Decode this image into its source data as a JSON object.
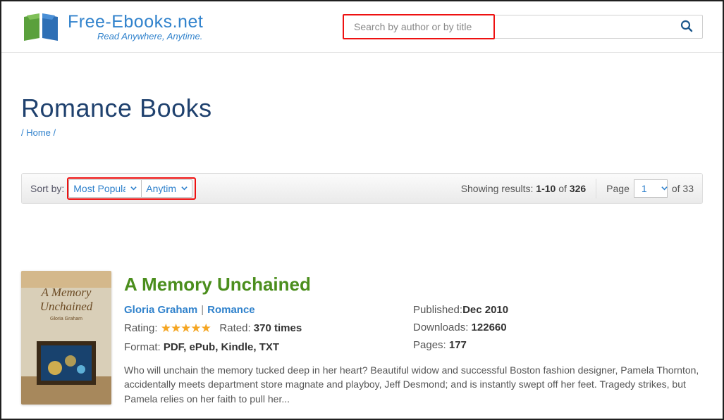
{
  "header": {
    "brand": "Free-Ebooks.net",
    "tagline": "Read Anywhere, Anytime.",
    "search_placeholder": "Search by author or by title"
  },
  "page": {
    "title": "Romance Books",
    "breadcrumb": "/ Home /"
  },
  "filter": {
    "sort_label": "Sort by:",
    "sort_value": "Most Popular",
    "date_value": "Anytime",
    "showing_prefix": "Showing results: ",
    "range": "1-10",
    "of_word": " of ",
    "total_results": "326",
    "page_label": "Page",
    "page_value": "1",
    "of_total_pages": "of 33"
  },
  "book": {
    "title": "A Memory Unchained",
    "author": "Gloria Graham",
    "category": "Romance",
    "rating_label": "Rating: ",
    "rated_label": "Rated: ",
    "rating_count": "370 times",
    "format_label": "Format: ",
    "format_value": "PDF, ePub, Kindle, TXT",
    "published_label": "Published: ",
    "published_value": "Dec 2010",
    "downloads_label": "Downloads: ",
    "downloads_value": "122660",
    "pages_label": "Pages: ",
    "pages_value": "177",
    "description": "Who will unchain the memory tucked deep in her heart? Beautiful widow and successful Boston fashion designer, Pamela Thornton, accidentally meets department store magnate and playboy, Jeff Desmond; and is instantly swept off her feet. Tragedy strikes, but Pamela relies on her faith to pull her..."
  }
}
